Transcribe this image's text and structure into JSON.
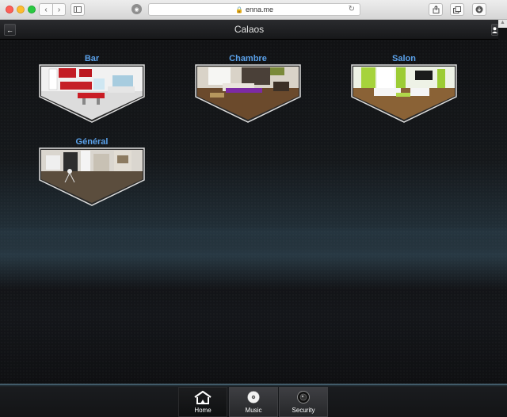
{
  "browser": {
    "url": "enna.me",
    "lock_glyph": "🔒",
    "reload_glyph": "↻",
    "back_glyph": "‹",
    "forward_glyph": "›"
  },
  "header": {
    "title": "Calaos",
    "back_icon": "←",
    "user_icon": "▲"
  },
  "rooms": [
    {
      "name": "Bar",
      "scene": "kitchen-red"
    },
    {
      "name": "Chambre",
      "scene": "bedroom-purple"
    },
    {
      "name": "Salon",
      "scene": "livingroom-green"
    },
    {
      "name": "Général",
      "scene": "studio-white"
    }
  ],
  "tabs": [
    {
      "label": "Home",
      "icon": "house-icon",
      "active": true
    },
    {
      "label": "Music",
      "icon": "disc-icon",
      "active": false
    },
    {
      "label": "Security",
      "icon": "camera-icon",
      "active": false
    }
  ],
  "colors": {
    "room_label": "#5aa0e8",
    "accent_bar": "#5b7d90"
  }
}
